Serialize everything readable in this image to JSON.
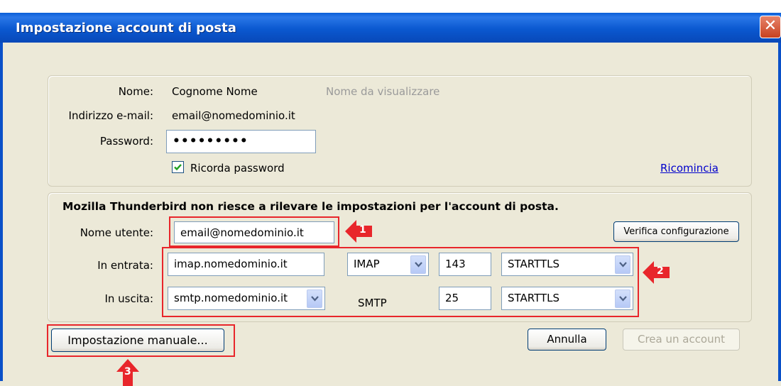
{
  "window": {
    "title": "Impostazione account di posta",
    "close_glyph": "✕"
  },
  "account": {
    "name_label": "Nome:",
    "name_value": "Cognome Nome",
    "name_hint": "Nome da visualizzare",
    "email_label": "Indirizzo e-mail:",
    "email_value": "email@nomedominio.it",
    "password_label": "Password:",
    "password_value": "•••••••••",
    "remember_label": "Ricorda password",
    "remember_checked": true,
    "restart_link": "Ricomincia"
  },
  "config": {
    "message": "Mozilla Thunderbird non riesce a rilevare le impostazioni per l'account di posta.",
    "username_label": "Nome utente:",
    "username_value": "email@nomedominio.it",
    "verify_button": "Verifica configurazione",
    "incoming_label": "In entrata:",
    "incoming_server": "imap.nomedominio.it",
    "incoming_protocol": "IMAP",
    "incoming_port": "143",
    "incoming_security": "STARTTLS",
    "outgoing_label": "In uscita:",
    "outgoing_server": "smtp.nomedominio.it",
    "outgoing_protocol": "SMTP",
    "outgoing_port": "25",
    "outgoing_security": "STARTTLS"
  },
  "footer": {
    "manual_button": "Impostazione manuale...",
    "cancel_button": "Annulla",
    "create_button": "Crea un account"
  },
  "annotations": {
    "marker_1": "1",
    "marker_2": "2",
    "marker_3": "3"
  },
  "colors": {
    "titlebar": "#0a58d0",
    "annotation_red": "#e8262b",
    "link": "#0000cc"
  }
}
